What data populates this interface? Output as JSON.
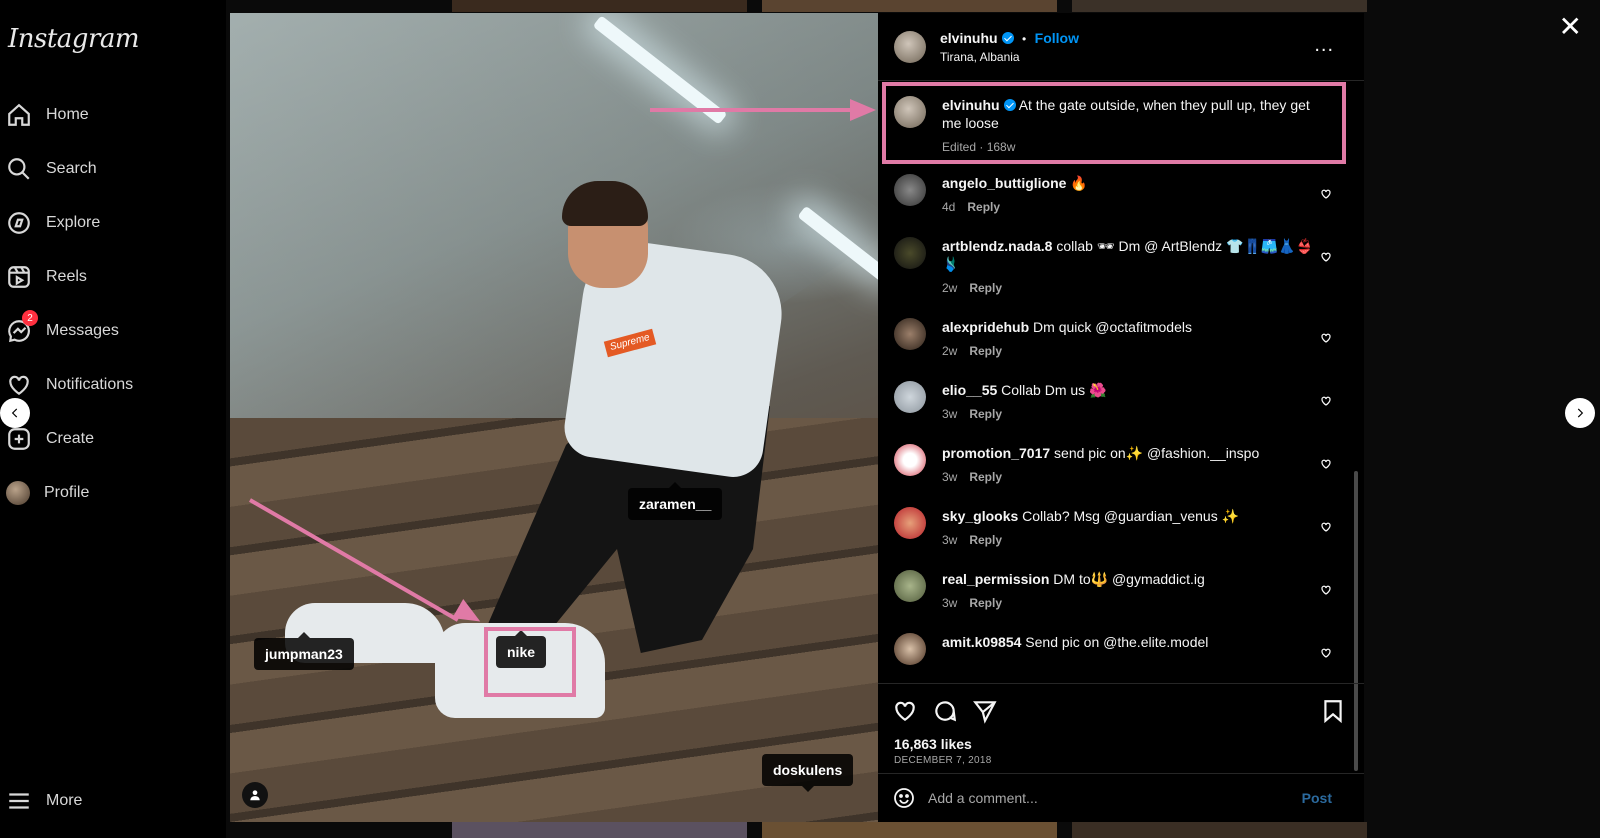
{
  "sidebar": {
    "logo": "Instagram",
    "items": [
      {
        "label": "Home"
      },
      {
        "label": "Search"
      },
      {
        "label": "Explore"
      },
      {
        "label": "Reels"
      },
      {
        "label": "Messages",
        "badge": "2"
      },
      {
        "label": "Notifications"
      },
      {
        "label": "Create"
      },
      {
        "label": "Profile"
      }
    ],
    "more": "More"
  },
  "photo": {
    "tags": {
      "t1": "zaramen__",
      "t2": "jumpman23",
      "t3": "nike",
      "t4": "doskulens"
    },
    "shirt_logo": "Supreme"
  },
  "post": {
    "username": "elvinuhu",
    "follow": "Follow",
    "separator": "•",
    "location": "Tirana, Albania",
    "caption": "At the gate outside, when they pull up, they get me loose",
    "caption_meta": "Edited · 168w",
    "likes": "16,863 likes",
    "date": "DECEMBER 7, 2018",
    "add_comment_placeholder": "Add a comment...",
    "post_button": "Post"
  },
  "comments": [
    {
      "user": "angelo_buttiglione",
      "text": "🔥",
      "age": "4d",
      "reply": "Reply"
    },
    {
      "user": "artblendz.nada.8",
      "text": "collab 🕶 Dm @ ArtBlendz 👕👖🩳👗👙🩱",
      "age": "2w",
      "reply": "Reply"
    },
    {
      "user": "alexpridehub",
      "text": "Dm quick @octafitmodels",
      "age": "2w",
      "reply": "Reply"
    },
    {
      "user": "elio__55",
      "text": "Collab Dm us 🌺",
      "age": "3w",
      "reply": "Reply"
    },
    {
      "user": "promotion_7017",
      "text": "send pic on✨ @fashion.__inspo",
      "age": "3w",
      "reply": "Reply"
    },
    {
      "user": "sky_glooks",
      "text": "Collab? Msg @guardian_venus ✨",
      "age": "3w",
      "reply": "Reply"
    },
    {
      "user": "real_permission",
      "text": "DM to🔱 @gymaddict.ig",
      "age": "3w",
      "reply": "Reply"
    },
    {
      "user": "amit.k09854",
      "text": "Send pic on @the.elite.model",
      "age": "",
      "reply": ""
    }
  ],
  "colors": {
    "annotation": "#e07aa6",
    "link": "#0095f6",
    "badge": "#ff3040"
  }
}
